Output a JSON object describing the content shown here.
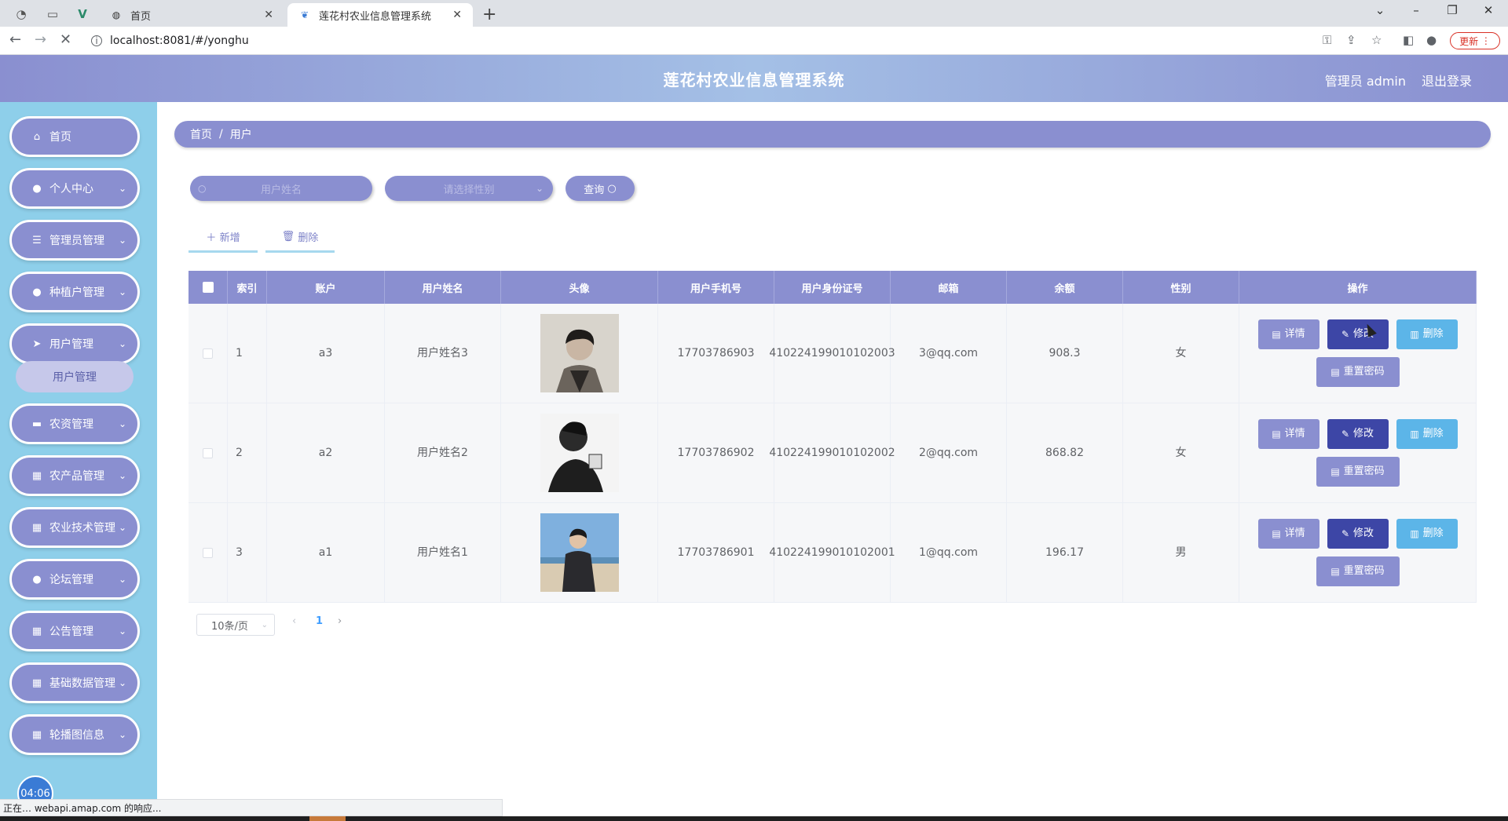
{
  "browser": {
    "tabs": [
      {
        "label": "首页"
      },
      {
        "label": "莲花村农业信息管理系统"
      }
    ],
    "url": "localhost:8081/#/yonghu",
    "update_label": "更新",
    "status_text": "正在… webapi.amap.com 的响应..."
  },
  "header": {
    "title": "莲花村农业信息管理系统",
    "user": "管理员 admin",
    "logout": "退出登录"
  },
  "sidebar": {
    "items": [
      {
        "label": "首页",
        "icon": "home-icon"
      },
      {
        "label": "个人中心",
        "icon": "user-icon"
      },
      {
        "label": "管理员管理",
        "icon": "list-icon"
      },
      {
        "label": "种植户管理",
        "icon": "user-icon"
      },
      {
        "label": "用户管理",
        "icon": "send-icon"
      },
      {
        "label": "农资管理",
        "icon": "briefcase-icon"
      },
      {
        "label": "农产品管理",
        "icon": "grid-icon"
      },
      {
        "label": "农业技术管理",
        "icon": "grid-icon"
      },
      {
        "label": "论坛管理",
        "icon": "user-icon"
      },
      {
        "label": "公告管理",
        "icon": "grid-icon"
      },
      {
        "label": "基础数据管理",
        "icon": "grid-icon"
      },
      {
        "label": "轮播图信息",
        "icon": "grid-icon"
      }
    ],
    "submenu_active": "用户管理",
    "clock": "04:06"
  },
  "breadcrumb": {
    "home": "首页",
    "sep": "/",
    "current": "用户"
  },
  "search": {
    "name_placeholder": "用户姓名",
    "gender_placeholder": "请选择性别",
    "query_label": "查询"
  },
  "actions": {
    "add": "新增",
    "delete": "删除"
  },
  "table": {
    "headers": [
      "索引",
      "账户",
      "用户姓名",
      "头像",
      "用户手机号",
      "用户身份证号",
      "邮箱",
      "余额",
      "性别",
      "操作"
    ],
    "rows": [
      {
        "index": "1",
        "account": "a3",
        "name": "用户姓名3",
        "phone": "17703786903",
        "id_card": "410224199010102003",
        "email": "3@qq.com",
        "balance": "908.3",
        "gender": "女"
      },
      {
        "index": "2",
        "account": "a2",
        "name": "用户姓名2",
        "phone": "17703786902",
        "id_card": "410224199010102002",
        "email": "2@qq.com",
        "balance": "868.82",
        "gender": "女"
      },
      {
        "index": "3",
        "account": "a1",
        "name": "用户姓名1",
        "phone": "17703786901",
        "id_card": "410224199010102001",
        "email": "1@qq.com",
        "balance": "196.17",
        "gender": "男"
      }
    ],
    "buttons": {
      "detail": "详情",
      "edit": "修改",
      "delete": "删除",
      "reset": "重置密码"
    }
  },
  "pagination": {
    "page_size": "10条/页",
    "current_page": "1"
  }
}
